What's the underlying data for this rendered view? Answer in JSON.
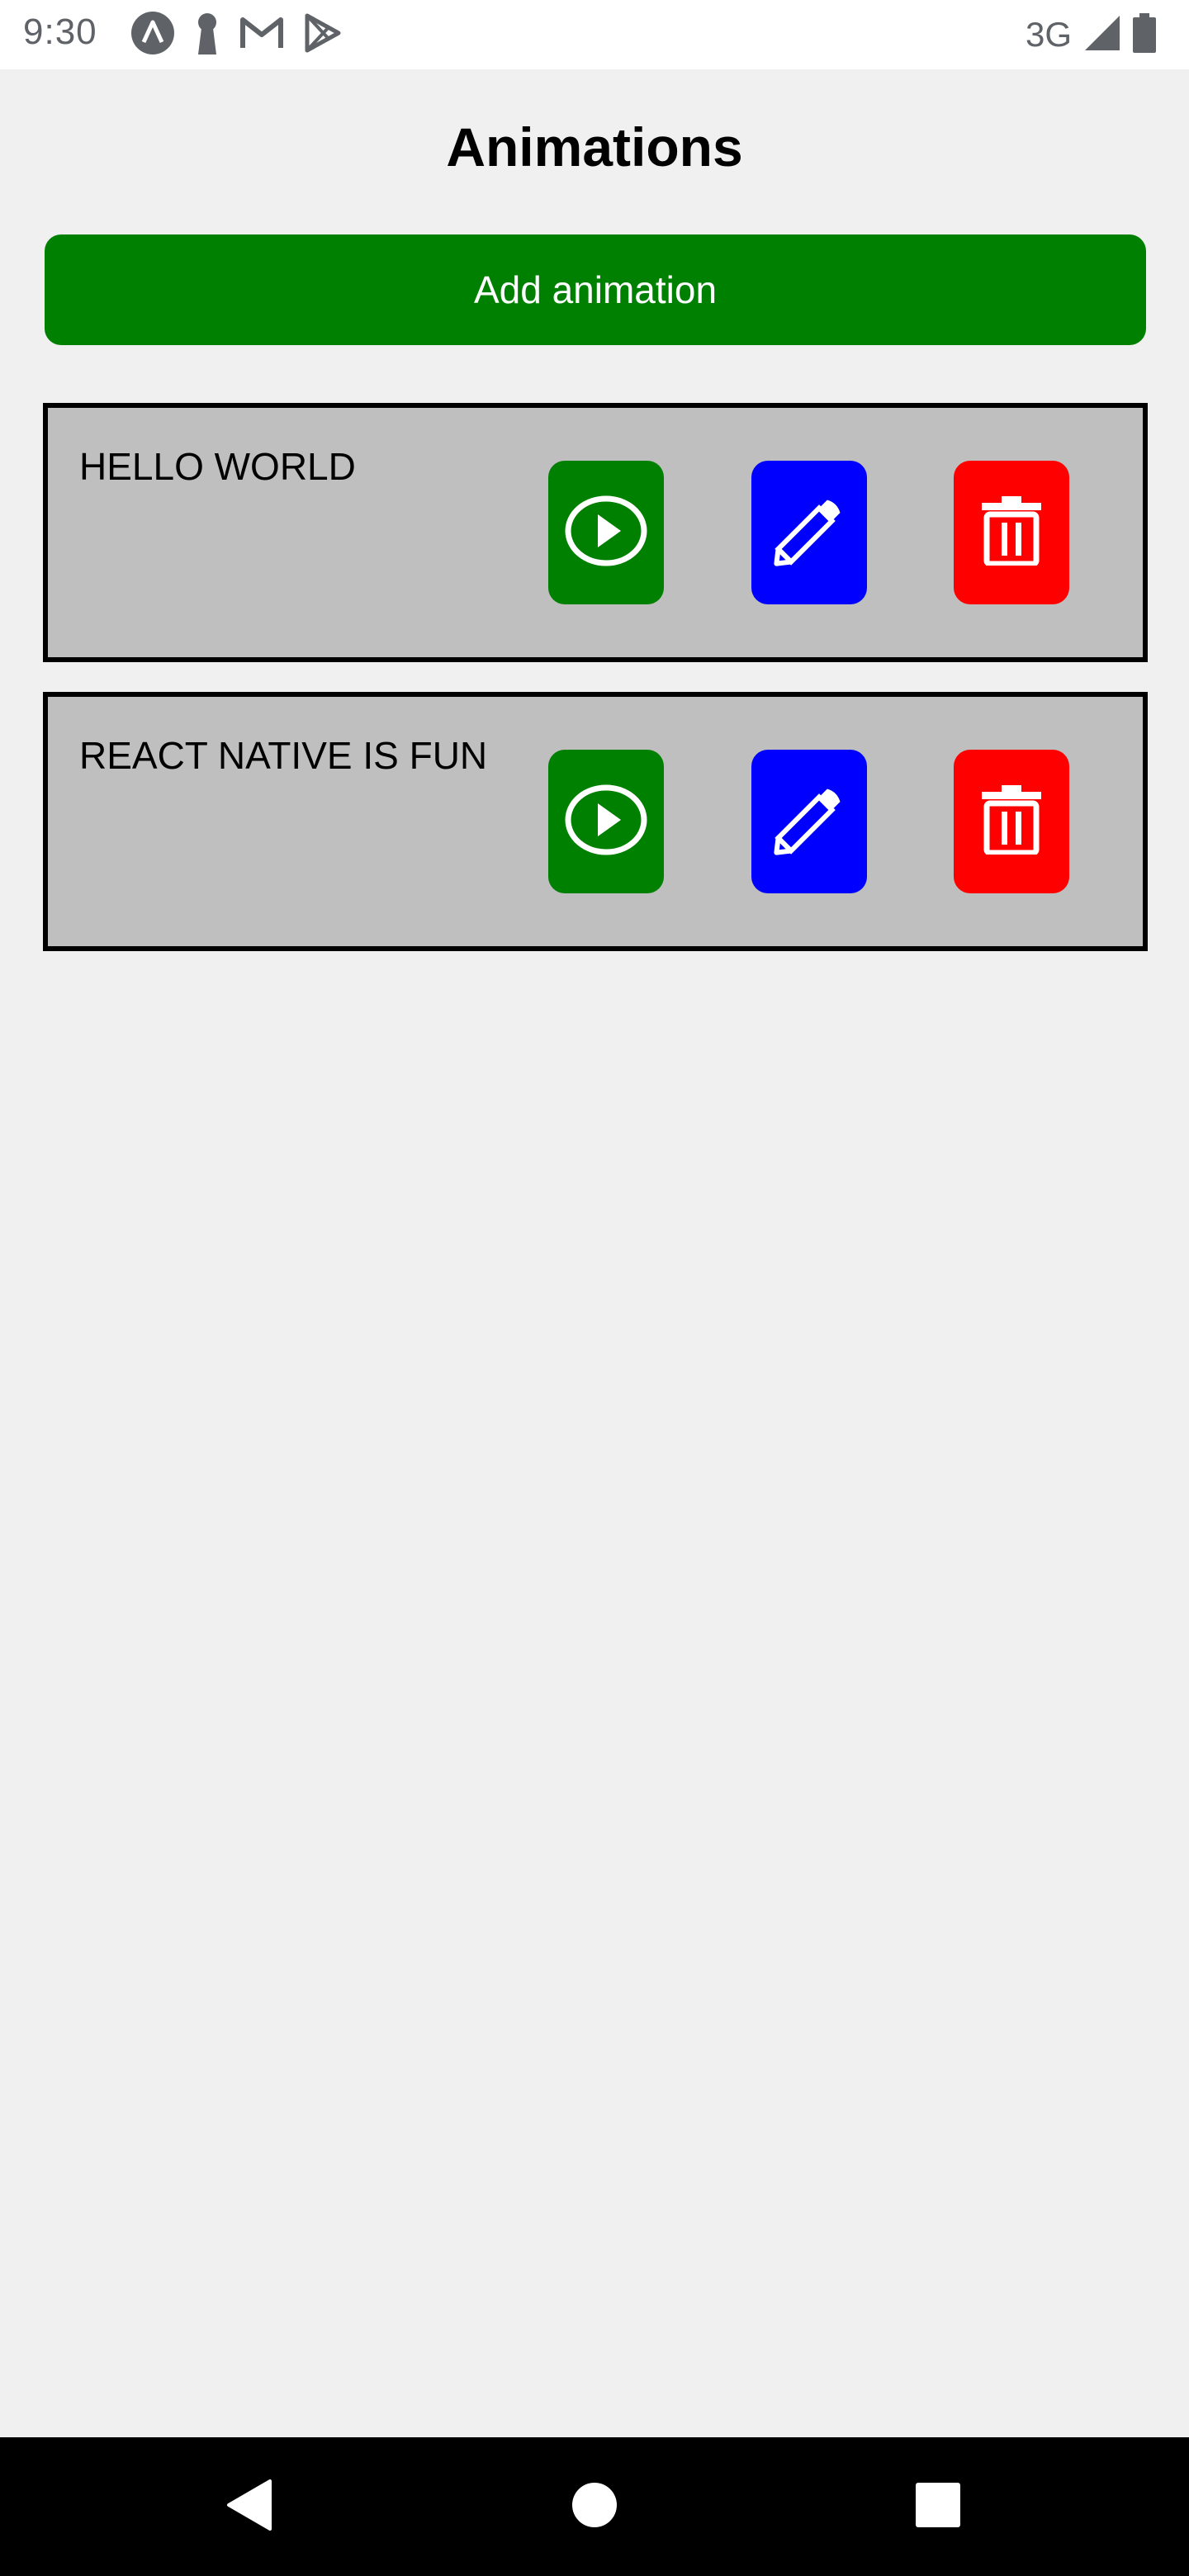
{
  "status_bar": {
    "time": "9:30",
    "network": "3G",
    "left_icons": [
      "a-logo-icon",
      "keyhole-icon",
      "gmail-icon",
      "play-store-icon"
    ],
    "right_icons": [
      "signal-icon",
      "battery-icon"
    ]
  },
  "page": {
    "title": "Animations"
  },
  "add_button": {
    "label": "Add animation",
    "color": "#008000"
  },
  "animations": [
    {
      "text": "HELLO WORLD"
    },
    {
      "text": "REACT NATIVE IS FUN"
    }
  ],
  "actions": {
    "play": {
      "icon": "play-circle-icon",
      "color": "#008000"
    },
    "edit": {
      "icon": "pencil-icon",
      "color": "#0000ff"
    },
    "delete": {
      "icon": "trash-icon",
      "color": "#ff0000"
    }
  },
  "nav_bar": {
    "icons": [
      "back-icon",
      "home-icon",
      "recents-icon"
    ]
  }
}
